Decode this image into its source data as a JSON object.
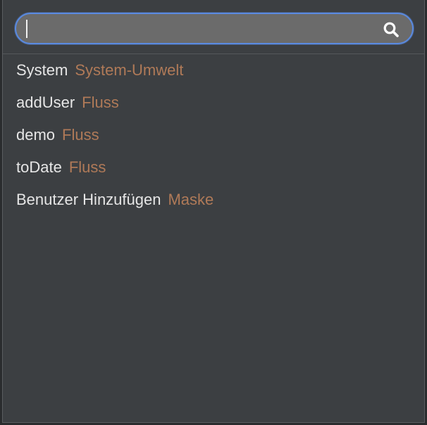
{
  "search": {
    "value": "",
    "icon": "search-icon"
  },
  "results": [
    {
      "name": "System",
      "type": "System-Umwelt"
    },
    {
      "name": "addUser",
      "type": "Fluss"
    },
    {
      "name": "demo",
      "type": "Fluss"
    },
    {
      "name": "toDate",
      "type": "Fluss"
    },
    {
      "name": "Benutzer Hinzufügen",
      "type": "Maske"
    }
  ],
  "colors": {
    "background": "#3c3f42",
    "accent": "#5a8ae0",
    "name_text": "#e6e6e6",
    "type_text": "#b07a58",
    "search_fill": "#6b6b6b"
  }
}
